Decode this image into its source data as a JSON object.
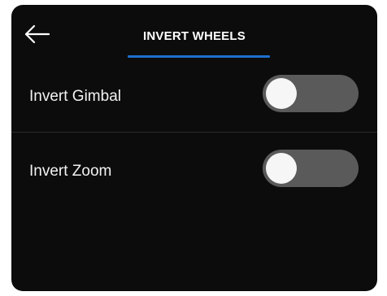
{
  "header": {
    "title": "INVERT WHEELS",
    "back_icon": "arrow-left-icon"
  },
  "settings": [
    {
      "label": "Invert Gimbal",
      "enabled": false
    },
    {
      "label": "Invert Zoom",
      "enabled": false
    }
  ],
  "colors": {
    "background": "#0c0c0c",
    "accent": "#1f6fd1",
    "toggle_off_track": "#5a5a5a",
    "knob": "#f6f6f6"
  }
}
